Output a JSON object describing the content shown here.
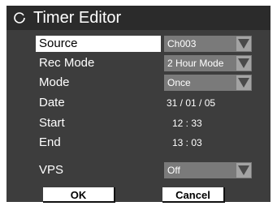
{
  "title": "Timer Editor",
  "icons": {
    "title": "timer-icon",
    "dropdown": "chevron-down-icon"
  },
  "rows": {
    "source": {
      "label": "Source",
      "value": "Ch003"
    },
    "rec_mode": {
      "label": "Rec Mode",
      "value": "2 Hour Mode"
    },
    "mode": {
      "label": "Mode",
      "value": "Once"
    },
    "date": {
      "label": "Date",
      "value": "31 / 01 / 05"
    },
    "start": {
      "label": "Start",
      "value": "12 : 33"
    },
    "end": {
      "label": "End",
      "value": "13 : 03"
    },
    "vps": {
      "label": "VPS",
      "value": "Off"
    }
  },
  "buttons": {
    "ok": "OK",
    "cancel": "Cancel"
  },
  "colors": {
    "background": "#3d3d3d",
    "titlebar": "#2b2b2b",
    "control": "#7a7a7a",
    "selection": "#ffffff"
  }
}
